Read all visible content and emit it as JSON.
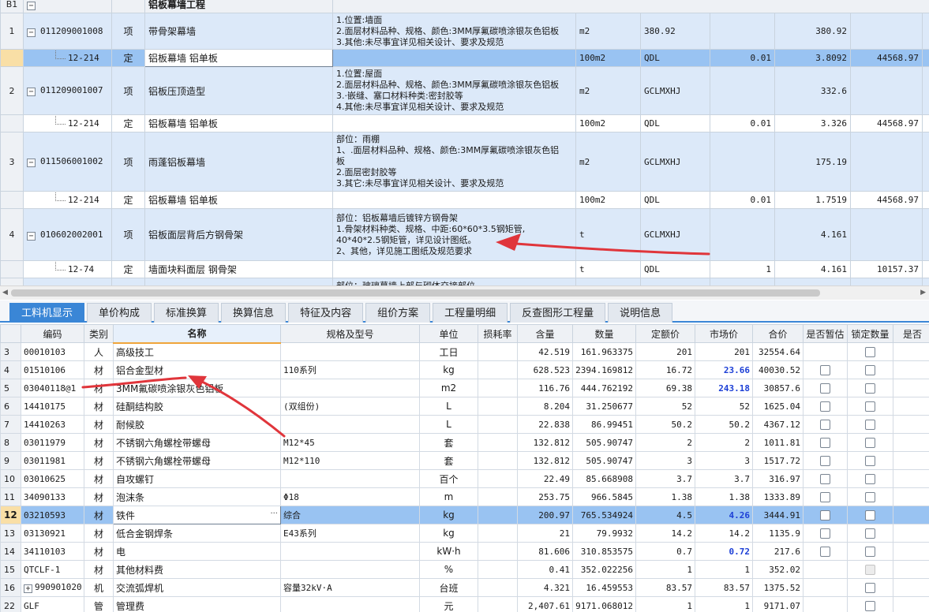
{
  "upper": {
    "section": {
      "idx": "B1",
      "toggle": "−",
      "name": "铝板幕墙工程"
    },
    "rows": [
      {
        "kind": "item",
        "style": "blue",
        "idx": "1",
        "code": "011209001008",
        "type": "项",
        "name": "带骨架幕墙",
        "desc": [
          "1.位置:墙面",
          "2.面层材料品种、规格、颜色:3MM厚氟碳喷涂银灰色铝板",
          "3.其他:未尽事宜详见相关设计、要求及规范"
        ],
        "unit": "m2",
        "expr": "380.92",
        "qty_factor": "",
        "qty": "380.92",
        "price": "",
        "h": 46
      },
      {
        "kind": "quota",
        "style": "sel",
        "idx": "",
        "code": "12-214",
        "type": "定",
        "name": "铝板幕墙 铝单板",
        "desc": [],
        "unit": "100m2",
        "expr": "QDL",
        "qty_factor": "0.01",
        "qty": "3.8092",
        "price": "44568.97",
        "h": 22,
        "edit": true
      },
      {
        "kind": "item",
        "style": "blue",
        "idx": "2",
        "code": "011209001007",
        "type": "项",
        "name": "铝板压顶造型",
        "desc": [
          "1.位置:屋面",
          "2.面层材料品种、规格、颜色:3MM厚氟碳喷涂银灰色铝板",
          "3.·嵌缝、塞口材料种类:密封胶等",
          "4.其他:未尽事宜详见相关设计、要求及规范"
        ],
        "unit": "m2",
        "expr": "GCLMXHJ",
        "qty_factor": "",
        "qty": "332.6",
        "price": "",
        "h": 61
      },
      {
        "kind": "quota",
        "style": "white",
        "idx": "",
        "code": "12-214",
        "type": "定",
        "name": "铝板幕墙 铝单板",
        "desc": [],
        "unit": "100m2",
        "expr": "QDL",
        "qty_factor": "0.01",
        "qty": "3.326",
        "price": "44568.97",
        "h": 22
      },
      {
        "kind": "item",
        "style": "blue",
        "idx": "3",
        "code": "011506001002",
        "type": "项",
        "name": "雨蓬铝板幕墙",
        "desc": [
          "部位：雨棚",
          "1、.面层材料品种、规格、颜色:3MM厚氟碳喷涂银灰色铝",
          "板",
          "2.面层密封胶等",
          "3.其它:未尽事宜详见相关设计、要求及规范"
        ],
        "unit": "m2",
        "expr": "GCLMXHJ",
        "qty_factor": "",
        "qty": "175.19",
        "price": "",
        "h": 75
      },
      {
        "kind": "quota",
        "style": "white",
        "idx": "",
        "code": "12-214",
        "type": "定",
        "name": "铝板幕墙 铝单板",
        "desc": [],
        "unit": "100m2",
        "expr": "QDL",
        "qty_factor": "0.01",
        "qty": "1.7519",
        "price": "44568.97",
        "h": 22
      },
      {
        "kind": "item",
        "style": "blue",
        "idx": "4",
        "code": "010602002001",
        "type": "项",
        "name": "铝板面层背后方钢骨架",
        "desc": [
          "部位：铝板幕墙后镀锌方钢骨架",
          "1.骨架材料种类、规格、中距:60*60*3.5钢矩管,",
          "40*40*2.5钢矩管，详见设计图纸。",
          "2、其他，详见施工图纸及规范要求"
        ],
        "unit": "t",
        "expr": "GCLMXHJ",
        "qty_factor": "",
        "qty": "4.161",
        "price": "",
        "h": 66
      },
      {
        "kind": "quota",
        "style": "white",
        "idx": "",
        "code": "12-74",
        "type": "定",
        "name": "墙面块料面层 钢骨架",
        "desc": [],
        "unit": "t",
        "expr": "QDL",
        "qty_factor": "1",
        "qty": "4.161",
        "price": "10157.37",
        "h": 22
      },
      {
        "kind": "item",
        "style": "blue",
        "idx": "",
        "code": "",
        "type": "",
        "name": "",
        "desc": [
          "部位：玻璃幕墙上部与砌体交接部位"
        ],
        "unit": "",
        "expr": "",
        "qty_factor": "",
        "qty": "",
        "price": "",
        "h": 20
      }
    ]
  },
  "tabs": [
    "工料机显示",
    "单价构成",
    "标准换算",
    "换算信息",
    "特征及内容",
    "组价方案",
    "工程量明细",
    "反查图形工程量",
    "说明信息"
  ],
  "active_tab": 0,
  "lower": {
    "headers": [
      "",
      "编码",
      "类别",
      "名称",
      "规格及型号",
      "单位",
      "损耗率",
      "含量",
      "数量",
      "定额价",
      "市场价",
      "合价",
      "是否暂估",
      "锁定数量",
      "是否"
    ],
    "rows": [
      {
        "idx": "3",
        "code": "00010103",
        "cat": "人",
        "name": "高级技工",
        "spec": "",
        "unit": "工日",
        "loss": "",
        "content": "42.519",
        "qty": "161.963375",
        "quota": "201",
        "market": "201",
        "total": "32554.64",
        "temp": false,
        "lock": true,
        "hl": false
      },
      {
        "idx": "4",
        "code": "01510106",
        "cat": "材",
        "name": "铝合金型材",
        "spec": "110系列",
        "unit": "kg",
        "loss": "",
        "content": "628.523",
        "qty": "2394.169812",
        "quota": "16.72",
        "market": "23.66",
        "total": "40030.52",
        "temp": true,
        "lock": true,
        "hl": true
      },
      {
        "idx": "5",
        "code": "03040118@1",
        "cat": "材",
        "name": "3MM氟碳喷涂银灰色铝板",
        "spec": "",
        "unit": "m2",
        "loss": "",
        "content": "116.76",
        "qty": "444.762192",
        "quota": "69.38",
        "market": "243.18",
        "total": "30857.6",
        "temp": true,
        "lock": true,
        "hl": true
      },
      {
        "idx": "6",
        "code": "14410175",
        "cat": "材",
        "name": "硅酮结构胶",
        "spec": "(双组份)",
        "unit": "L",
        "loss": "",
        "content": "8.204",
        "qty": "31.250677",
        "quota": "52",
        "market": "52",
        "total": "1625.04",
        "temp": true,
        "lock": true,
        "hl": false
      },
      {
        "idx": "7",
        "code": "14410263",
        "cat": "材",
        "name": "耐候胶",
        "spec": "",
        "unit": "L",
        "loss": "",
        "content": "22.838",
        "qty": "86.99451",
        "quota": "50.2",
        "market": "50.2",
        "total": "4367.12",
        "temp": true,
        "lock": true,
        "hl": false
      },
      {
        "idx": "8",
        "code": "03011979",
        "cat": "材",
        "name": "不锈钢六角螺栓带螺母",
        "spec": "M12*45",
        "unit": "套",
        "loss": "",
        "content": "132.812",
        "qty": "505.90747",
        "quota": "2",
        "market": "2",
        "total": "1011.81",
        "temp": true,
        "lock": true,
        "hl": false
      },
      {
        "idx": "9",
        "code": "03011981",
        "cat": "材",
        "name": "不锈钢六角螺栓带螺母",
        "spec": "M12*110",
        "unit": "套",
        "loss": "",
        "content": "132.812",
        "qty": "505.90747",
        "quota": "3",
        "market": "3",
        "total": "1517.72",
        "temp": true,
        "lock": true,
        "hl": false
      },
      {
        "idx": "10",
        "code": "03010625",
        "cat": "材",
        "name": "自攻螺钉",
        "spec": "",
        "unit": "百个",
        "loss": "",
        "content": "22.49",
        "qty": "85.668908",
        "quota": "3.7",
        "market": "3.7",
        "total": "316.97",
        "temp": true,
        "lock": true,
        "hl": false
      },
      {
        "idx": "11",
        "code": "34090133",
        "cat": "材",
        "name": "泡沫条",
        "spec": "Φ18",
        "unit": "m",
        "loss": "",
        "content": "253.75",
        "qty": "966.5845",
        "quota": "1.38",
        "market": "1.38",
        "total": "1333.89",
        "temp": true,
        "lock": true,
        "hl": false
      },
      {
        "idx": "12",
        "code": "03210593",
        "cat": "材",
        "name": "铁件",
        "spec": "综合",
        "unit": "kg",
        "loss": "",
        "content": "200.97",
        "qty": "765.534924",
        "quota": "4.5",
        "market": "4.26",
        "total": "3444.91",
        "temp": true,
        "lock": true,
        "hl": true,
        "sel": true
      },
      {
        "idx": "13",
        "code": "03130921",
        "cat": "材",
        "name": "低合金钢焊条",
        "spec": "E43系列",
        "unit": "kg",
        "loss": "",
        "content": "21",
        "qty": "79.9932",
        "quota": "14.2",
        "market": "14.2",
        "total": "1135.9",
        "temp": true,
        "lock": true,
        "hl": false
      },
      {
        "idx": "14",
        "code": "34110103",
        "cat": "材",
        "name": "电",
        "spec": "",
        "unit": "kW·h",
        "loss": "",
        "content": "81.606",
        "qty": "310.853575",
        "quota": "0.7",
        "market": "0.72",
        "total": "217.6",
        "temp": true,
        "lock": true,
        "hl": true
      },
      {
        "idx": "15",
        "code": "QTCLF-1",
        "cat": "材",
        "name": "其他材料费",
        "spec": "",
        "unit": "%",
        "loss": "",
        "content": "0.41",
        "qty": "352.022256",
        "quota": "1",
        "market": "1",
        "total": "352.02",
        "temp": false,
        "lock": "disabled",
        "hl": false
      },
      {
        "idx": "16",
        "code": "990901020",
        "cat": "机",
        "name": "交流弧焊机",
        "spec": "容量32kV·A",
        "unit": "台班",
        "loss": "",
        "content": "4.321",
        "qty": "16.459553",
        "quota": "83.57",
        "market": "83.57",
        "total": "1375.52",
        "temp": false,
        "lock": true,
        "hl": false,
        "plus": true
      },
      {
        "idx": "22",
        "code": "GLF",
        "cat": "管",
        "name": "管理费",
        "spec": "",
        "unit": "元",
        "loss": "",
        "content": "2,407.61",
        "qty": "9171.068012",
        "quota": "1",
        "market": "1",
        "total": "9171.07",
        "temp": false,
        "lock": true,
        "hl": false
      }
    ]
  },
  "colors": {
    "accent": "#3a86d6",
    "selected_row": "#99c3f2",
    "blue_row": "#dce9f9",
    "price_highlight": "#1c3fd6",
    "arrow": "#e0353b"
  },
  "icons": {
    "collapse": "minus-box-icon",
    "expand": "plus-box-icon",
    "more": "ellipsis-icon"
  }
}
